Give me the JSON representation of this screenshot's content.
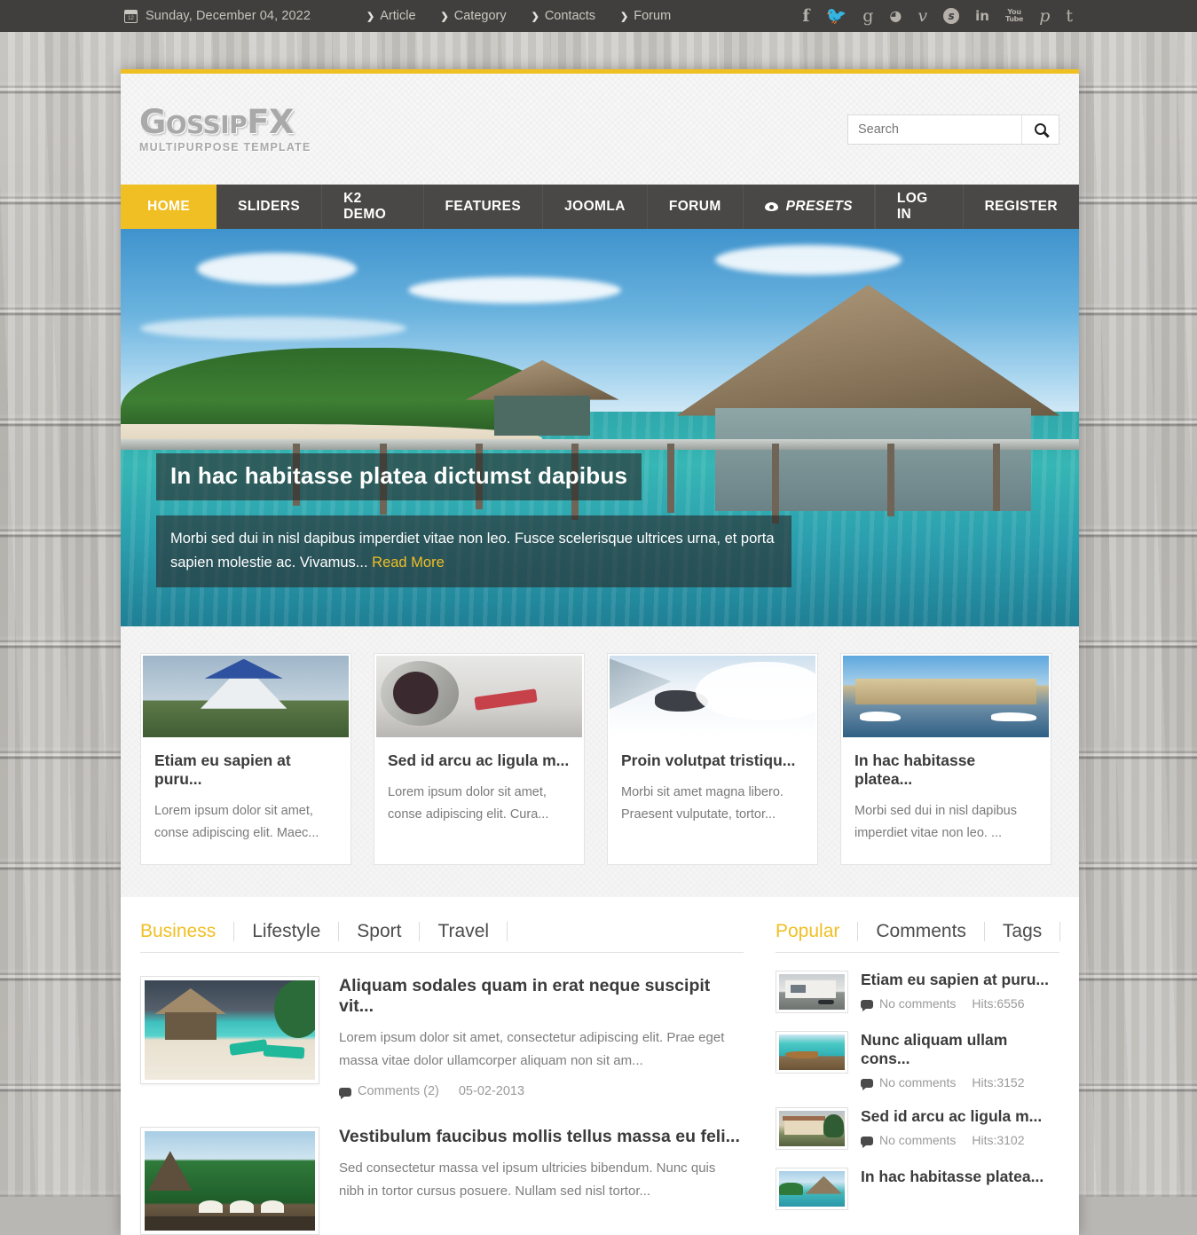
{
  "topbar": {
    "date": "Sunday, December 04, 2022",
    "calendar_icon": "calendar-icon",
    "links": [
      "Article",
      "Category",
      "Contacts",
      "Forum"
    ],
    "socials": [
      "facebook",
      "twitter",
      "google-plus",
      "rss",
      "vimeo",
      "skype",
      "linkedin",
      "youtube",
      "pinterest",
      "tumblr"
    ],
    "social_glyphs": [
      "f",
      "🐦",
      "g",
      "◜",
      "v",
      "s",
      "in",
      "YouTube",
      "𝒫",
      "t"
    ]
  },
  "header": {
    "logo_main_1": "G",
    "logo_main_2": "OSSIP",
    "logo_main_3": "FX",
    "logo_sub": "Multipurpose Template",
    "search": {
      "placeholder": "Search",
      "value": "",
      "button_icon": "search-icon"
    }
  },
  "nav": {
    "items": [
      {
        "label": "HOME",
        "active": true
      },
      {
        "label": "SLIDERS",
        "active": false
      },
      {
        "label": "K2 DEMO",
        "active": false
      },
      {
        "label": "FEATURES",
        "active": false
      },
      {
        "label": "JOOMLA",
        "active": false
      },
      {
        "label": "FORUM",
        "active": false
      },
      {
        "label": "PRESETS",
        "active": false
      }
    ],
    "right_items": [
      {
        "label": "LOG IN"
      },
      {
        "label": "REGISTER"
      }
    ]
  },
  "slider": {
    "title": "In hac habitasse platea dictumst dapibus",
    "description": "Morbi sed dui in nisl dapibus imperdiet vitae non leo. Fusce scelerisque ultrices urna, et porta sapien molestie ac. Vivamus...",
    "read_more": "Read More"
  },
  "cards": [
    {
      "title": "Etiam eu sapien at puru...",
      "text": "Lorem ipsum dolor sit amet, conse adipiscing elit. Maec...",
      "image": "temple-thumbnail"
    },
    {
      "title": "Sed id arcu ac ligula m...",
      "text": "Lorem ipsum dolor sit amet, conse adipiscing elit. Cura...",
      "image": "airplane-thumbnail"
    },
    {
      "title": "Proin volutpat tristiqu...",
      "text": "Morbi sit amet magna libero. Praesent vulputate, tortor...",
      "image": "snowboard-thumbnail"
    },
    {
      "title": "In hac habitasse platea...",
      "text": "Morbi sed dui in nisl dapibus imperdiet vitae non leo. ...",
      "image": "resort-thumbnail"
    }
  ],
  "content_tabs": [
    {
      "label": "Business",
      "active": true
    },
    {
      "label": "Lifestyle",
      "active": false
    },
    {
      "label": "Sport",
      "active": false
    },
    {
      "label": "Travel",
      "active": false
    }
  ],
  "posts": [
    {
      "title": "Aliquam sodales quam in erat neque suscipit vit...",
      "text": "Lorem ipsum dolor sit amet, consectetur adipiscing elit. Prae eget massa vitae dolor ullamcorper aliquam non sit am...",
      "comments": "Comments (2)",
      "date": "05-02-2013",
      "image": "beach-cabana-thumbnail"
    },
    {
      "title": "Vestibulum faucibus mollis tellus massa eu feli...",
      "text": "Sed consectetur massa vel ipsum ultricies bibendum. Nunc quis nibh in tortor cursus posuere. Nullam sed nisl tortor...",
      "comments": "",
      "date": "",
      "image": "palm-resort-thumbnail"
    }
  ],
  "sidebar_tabs": [
    {
      "label": "Popular",
      "active": true
    },
    {
      "label": "Comments",
      "active": false
    },
    {
      "label": "Tags",
      "active": false
    }
  ],
  "sidebar_items": [
    {
      "title": "Etiam eu sapien at puru...",
      "comments": "No comments",
      "hits": "Hits:6556",
      "image": "modern-house-thumbnail"
    },
    {
      "title": "Nunc aliquam ullam cons...",
      "comments": "No comments",
      "hits": "Hits:3152",
      "image": "lagoon-boat-thumbnail"
    },
    {
      "title": "Sed id arcu ac ligula m...",
      "comments": "No comments",
      "hits": "Hits:3102",
      "image": "villa-thumbnail"
    },
    {
      "title": "In hac habitasse platea...",
      "comments": "",
      "hits": "",
      "image": "overwater-hut-thumbnail"
    }
  ],
  "colors": {
    "accent": "#f0bf23",
    "nav_bg": "#4a4846",
    "topbar_bg": "#413f3d",
    "page_bg": "#ffffff",
    "muted_text": "#7d7d7d"
  }
}
